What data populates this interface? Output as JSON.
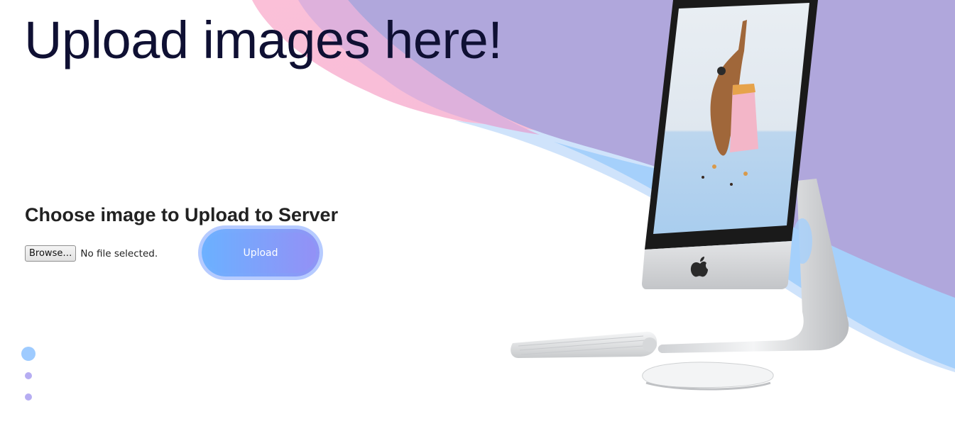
{
  "page": {
    "title": "Upload images here!"
  },
  "upload_form": {
    "heading": "Choose image to Upload to Server",
    "browse_label": "Browse…",
    "file_status": "No file selected.",
    "submit_label": "Upload"
  },
  "carousel": {
    "indicator_count": 3,
    "active_index": 0
  },
  "illustration": {
    "subject": "computer with keyboard and mouse",
    "icons": [
      "apple-logo-icon"
    ]
  },
  "colors": {
    "title_text": "#0f1033",
    "button_gradient_start": "#6eb1ff",
    "button_gradient_end": "#8f95f5",
    "wave_pink": "#f7bcd8",
    "wave_purple": "#b0a7dc",
    "wave_blue": "#a3cffb"
  }
}
